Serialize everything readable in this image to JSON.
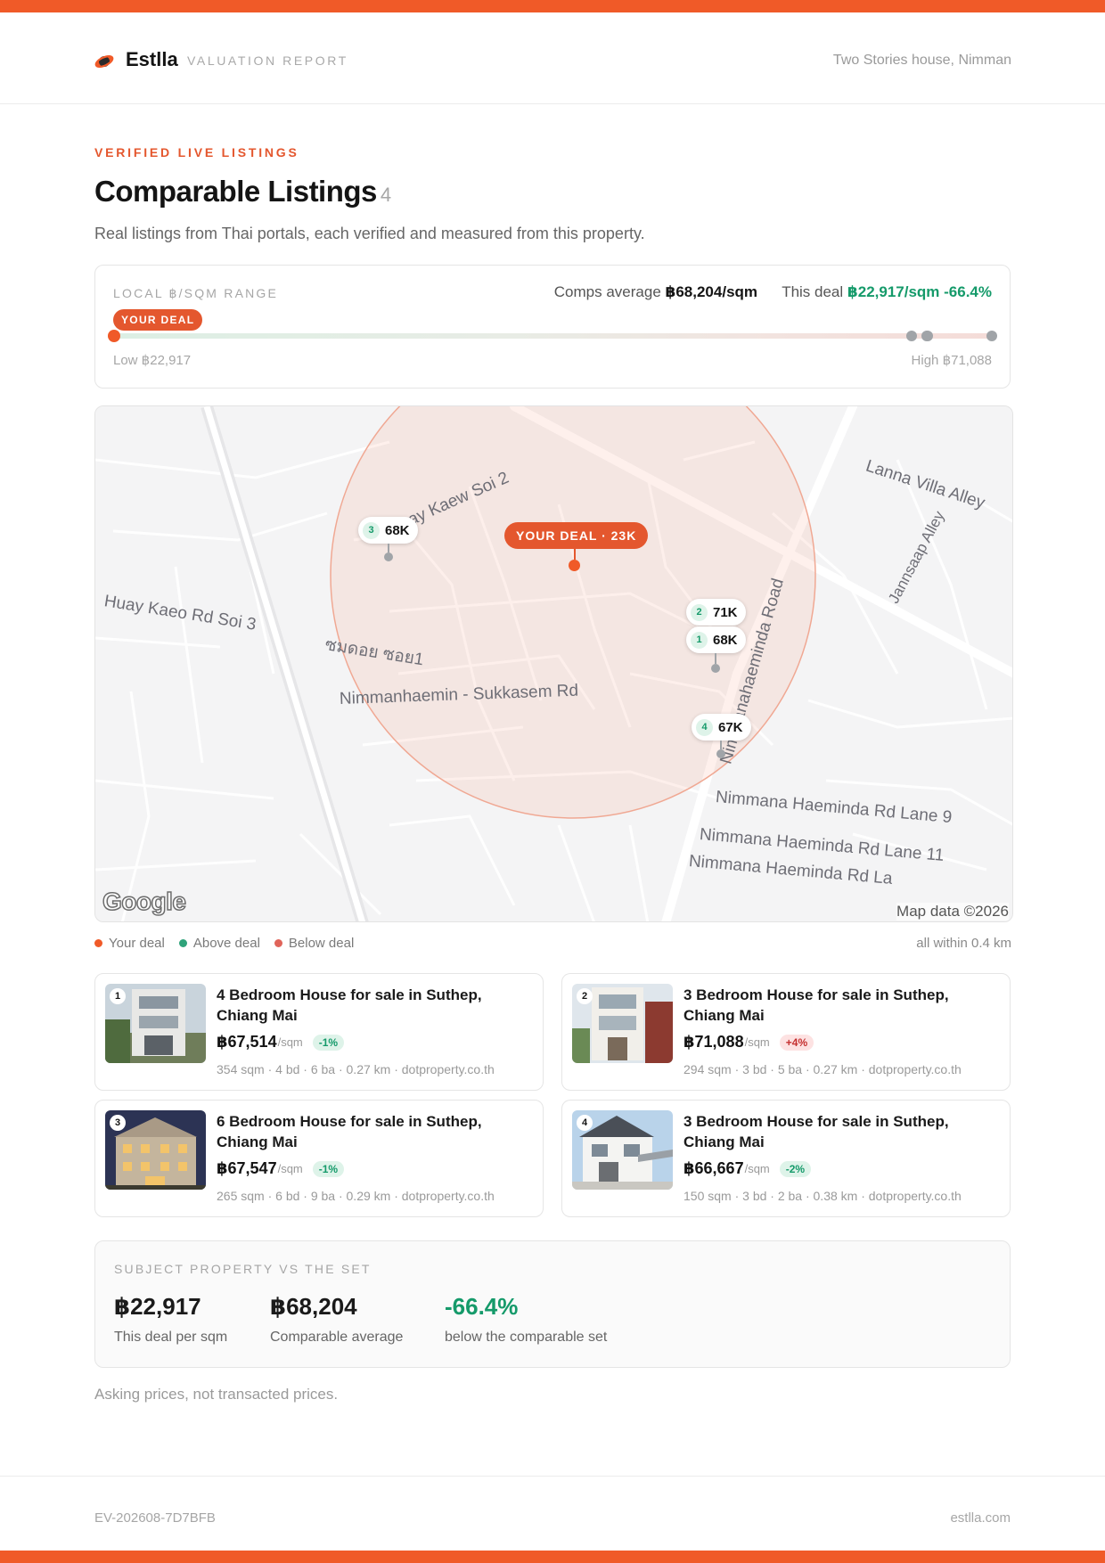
{
  "header": {
    "brand": "Estlla",
    "report_label": "VALUATION REPORT",
    "property": "Two Stories house, Nimman"
  },
  "section": {
    "eyebrow": "VERIFIED LIVE LISTINGS",
    "title": "Comparable Listings",
    "count": "4",
    "subtitle": "Real listings from Thai portals, each verified and measured from this property."
  },
  "range": {
    "label": "LOCAL ฿/SQM RANGE",
    "comps_avg_prefix": "Comps average",
    "comps_avg_value": "฿68,204/sqm",
    "this_deal_prefix": "This deal",
    "this_deal_value": "฿22,917/sqm -66.4%",
    "deal_pill": "YOUR DEAL",
    "low": "Low ฿22,917",
    "high": "High ฿71,088",
    "low_value": 22917,
    "high_value": 71088,
    "deal_value": 22917,
    "comp_values": [
      67514,
      71088,
      67547,
      66667
    ]
  },
  "map": {
    "deal_label": "YOUR DEAL · 23K",
    "pins": [
      {
        "num": "3",
        "label": "68K"
      },
      {
        "num": "2",
        "label": "71K"
      },
      {
        "num": "1",
        "label": "68K"
      },
      {
        "num": "4",
        "label": "67K"
      }
    ],
    "roads": [
      "Huay Kaew Soi 2",
      "Lanna Villa Alley",
      "Jannsaap Alley",
      "Huay Kaeo Rd Soi 3",
      "ซมดอย ซอย1",
      "Nimmanhaemin - Sukkasem Rd",
      "Nimmanahaeminda Road",
      "Nimmana Haeminda Rd Lane 9",
      "Nimmana Haeminda Rd Lane 11",
      "Nimmana Haeminda Rd La"
    ],
    "logo": "Google",
    "attribution": "Map data ©2026",
    "colors": {
      "deal": "#f05a28",
      "radius_fill": "#fbe8e2",
      "radius_stroke": "#f2bfae"
    }
  },
  "legend": {
    "items": [
      {
        "label": "Your deal",
        "color": "#f05a28"
      },
      {
        "label": "Above deal",
        "color": "#2fa37a"
      },
      {
        "label": "Below deal",
        "color": "#e0645a"
      }
    ],
    "right": "all within 0.4 km"
  },
  "listings": [
    {
      "num": "1",
      "title": "4 Bedroom House for sale in Suthep, Chiang Mai",
      "price": "฿67,514",
      "unit": "/sqm",
      "delta": "-1%",
      "delta_type": "good",
      "meta": "354 sqm · 4 bd · 6 ba · 0.27 km · dotproperty.co.th"
    },
    {
      "num": "2",
      "title": "3 Bedroom House for sale in Suthep, Chiang Mai",
      "price": "฿71,088",
      "unit": "/sqm",
      "delta": "+4%",
      "delta_type": "bad",
      "meta": "294 sqm · 3 bd · 5 ba · 0.27 km · dotproperty.co.th"
    },
    {
      "num": "3",
      "title": "6 Bedroom House for sale in Suthep, Chiang Mai",
      "price": "฿67,547",
      "unit": "/sqm",
      "delta": "-1%",
      "delta_type": "good",
      "meta": "265 sqm · 6 bd · 9 ba · 0.29 km · dotproperty.co.th"
    },
    {
      "num": "4",
      "title": "3 Bedroom House for sale in Suthep, Chiang Mai",
      "price": "฿66,667",
      "unit": "/sqm",
      "delta": "-2%",
      "delta_type": "good",
      "meta": "150 sqm · 3 bd · 2 ba · 0.38 km · dotproperty.co.th"
    }
  ],
  "summary": {
    "label": "SUBJECT PROPERTY VS THE SET",
    "deal_value": "฿22,917",
    "deal_caption": "This deal per sqm",
    "avg_value": "฿68,204",
    "avg_caption": "Comparable average",
    "diff_value": "-66.4%",
    "diff_caption": "below the comparable set"
  },
  "disclaimer": "Asking prices, not transacted prices.",
  "footer": {
    "id": "EV-202608-7D7BFB",
    "site": "estlla.com"
  }
}
